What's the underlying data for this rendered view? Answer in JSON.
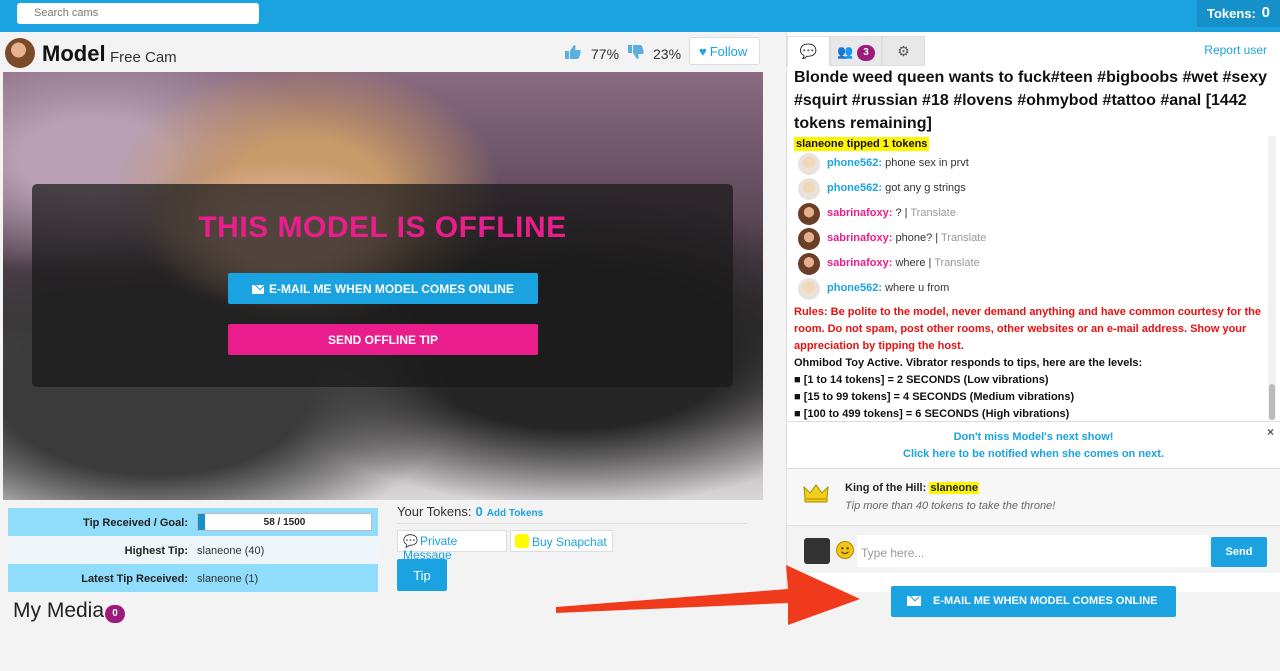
{
  "topbar": {
    "search_placeholder": "Search cams",
    "tokens_label": "Tokens:",
    "tokens_value": "0"
  },
  "header": {
    "model_name": "Model",
    "subtitle": "Free Cam",
    "like_pct": "77%",
    "dislike_pct": "23%",
    "follow_label": "Follow"
  },
  "video": {
    "offline_title": "THIS MODEL IS OFFLINE",
    "email_button": "E-MAIL ME WHEN MODEL COMES ONLINE",
    "tip_button": "SEND OFFLINE TIP"
  },
  "tips": {
    "goal_label": "Tip Received / Goal:",
    "goal_text": "58 / 1500",
    "goal_fraction": 0.0387,
    "highest_label": "Highest Tip:",
    "highest_value": "slaneone (40)",
    "latest_label": "Latest Tip Received:",
    "latest_value": "slaneone (1)"
  },
  "actions": {
    "your_tokens_label": "Your Tokens:",
    "your_tokens_value": "0",
    "add_tokens": "Add Tokens",
    "private_message": "Private Message",
    "buy_snapchat": "Buy Snapchat",
    "tip": "Tip"
  },
  "media": {
    "title": "My Media",
    "count": "0"
  },
  "chat": {
    "users_count": "3",
    "report_user": "Report user",
    "topic": "Blonde weed queen wants to fuck#teen #bigboobs #wet #sexy #squirt #russian #18 #lovens #ohmybod #tattoo #anal [1442 tokens remaining]",
    "tip_notice": "slaneone tipped 1 tokens",
    "messages": [
      {
        "user": "phone562:",
        "text": "phone sex in prvt",
        "translate": ""
      },
      {
        "user": "phone562:",
        "text": "got any g strings",
        "translate": ""
      },
      {
        "user": "sabrinafoxy:",
        "text": "? | ",
        "translate": "Translate"
      },
      {
        "user": "sabrinafoxy:",
        "text": "phone? | ",
        "translate": "Translate"
      },
      {
        "user": "sabrinafoxy:",
        "text": "where | ",
        "translate": "Translate"
      },
      {
        "user": "phone562:",
        "text": "where u from",
        "translate": ""
      }
    ],
    "rules": "Rules: Be polite to the model, never demand anything and have common courtesy for the room. Do not spam, post other rooms, other websites or an e-mail address. Show your appreciation by tipping the host.",
    "toy_intro": "Ohmibod Toy Active. Vibrator responds to tips, here are the levels:",
    "toy_levels": [
      "■ [1 to 14 tokens] = 2 SECONDS (Low vibrations)",
      "■ [15 to 99 tokens] = 4 SECONDS (Medium vibrations)",
      "■ [100 to 499 tokens] = 6 SECONDS (High vibrations)"
    ],
    "notify_line1": "Don't miss Model's next show!",
    "notify_line2": "Click here to be notified when she comes on next.",
    "close_symbol": "×",
    "king_label": "King of the Hill:",
    "king_name": "slaneone",
    "king_sub": "Tip more than 40 tokens to take the throne!",
    "input_placeholder": "Type here...",
    "send_label": "Send"
  },
  "bottom": {
    "email_button": "E-MAIL ME WHEN MODEL COMES ONLINE"
  },
  "colors": {
    "accent": "#1aa3e0",
    "pink": "#e91e8c",
    "arrow": "#f03a1c",
    "highlight": "#fff700"
  }
}
